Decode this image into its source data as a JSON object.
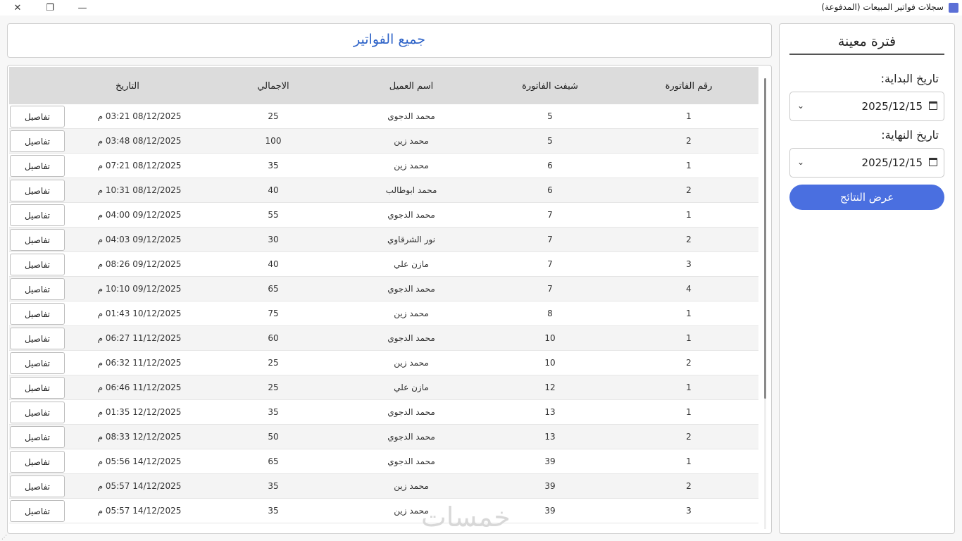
{
  "window": {
    "title": "سجلات فواتير المبيعات (المدفوعة)",
    "close": "✕",
    "restore": "❐",
    "minimize": "—"
  },
  "side": {
    "title": "فترة معينة",
    "start_label": "تاريخ البداية:",
    "start_value": "2025/12/15",
    "end_label": "تاريخ النهاية:",
    "end_value": "2025/12/15",
    "show_button": "عرض النتائج"
  },
  "header": {
    "title": "جميع الفواتير"
  },
  "table": {
    "columns": {
      "number": "رقم الفاتورة",
      "shift": "شيفت الفاتورة",
      "customer": "اسم العميل",
      "total": "الاجمالي",
      "date": "التاريخ"
    },
    "details_label": "تفاصيل",
    "rows": [
      {
        "number": "1",
        "shift": "5",
        "customer": "محمد الدجوي",
        "total": "25",
        "date": "08/12/2025 03:21 م"
      },
      {
        "number": "2",
        "shift": "5",
        "customer": "محمد زين",
        "total": "100",
        "date": "08/12/2025 03:48 م"
      },
      {
        "number": "1",
        "shift": "6",
        "customer": "محمد زين",
        "total": "35",
        "date": "08/12/2025 07:21 م"
      },
      {
        "number": "2",
        "shift": "6",
        "customer": "محمد ابوطالب",
        "total": "40",
        "date": "08/12/2025 10:31 م"
      },
      {
        "number": "1",
        "shift": "7",
        "customer": "محمد الدجوي",
        "total": "55",
        "date": "09/12/2025 04:00 م"
      },
      {
        "number": "2",
        "shift": "7",
        "customer": "نور الشرقاوي",
        "total": "30",
        "date": "09/12/2025 04:03 م"
      },
      {
        "number": "3",
        "shift": "7",
        "customer": "مازن علي",
        "total": "40",
        "date": "09/12/2025 08:26 م"
      },
      {
        "number": "4",
        "shift": "7",
        "customer": "محمد الدجوي",
        "total": "65",
        "date": "09/12/2025 10:10 م"
      },
      {
        "number": "1",
        "shift": "8",
        "customer": "محمد زين",
        "total": "75",
        "date": "10/12/2025 01:43 م"
      },
      {
        "number": "1",
        "shift": "10",
        "customer": "محمد الدجوي",
        "total": "60",
        "date": "11/12/2025 06:27 م"
      },
      {
        "number": "2",
        "shift": "10",
        "customer": "محمد زين",
        "total": "25",
        "date": "11/12/2025 06:32 م"
      },
      {
        "number": "1",
        "shift": "12",
        "customer": "مازن علي",
        "total": "25",
        "date": "11/12/2025 06:46 م"
      },
      {
        "number": "1",
        "shift": "13",
        "customer": "محمد الدجوي",
        "total": "35",
        "date": "12/12/2025 01:35 م"
      },
      {
        "number": "2",
        "shift": "13",
        "customer": "محمد الدجوي",
        "total": "50",
        "date": "12/12/2025 08:33 م"
      },
      {
        "number": "1",
        "shift": "39",
        "customer": "محمد الدجوي",
        "total": "65",
        "date": "14/12/2025 05:56 م"
      },
      {
        "number": "2",
        "shift": "39",
        "customer": "محمد زين",
        "total": "35",
        "date": "14/12/2025 05:57 م"
      },
      {
        "number": "3",
        "shift": "39",
        "customer": "محمد زين",
        "total": "35",
        "date": "14/12/2025 05:57 م"
      }
    ]
  },
  "watermark": "خمسات"
}
